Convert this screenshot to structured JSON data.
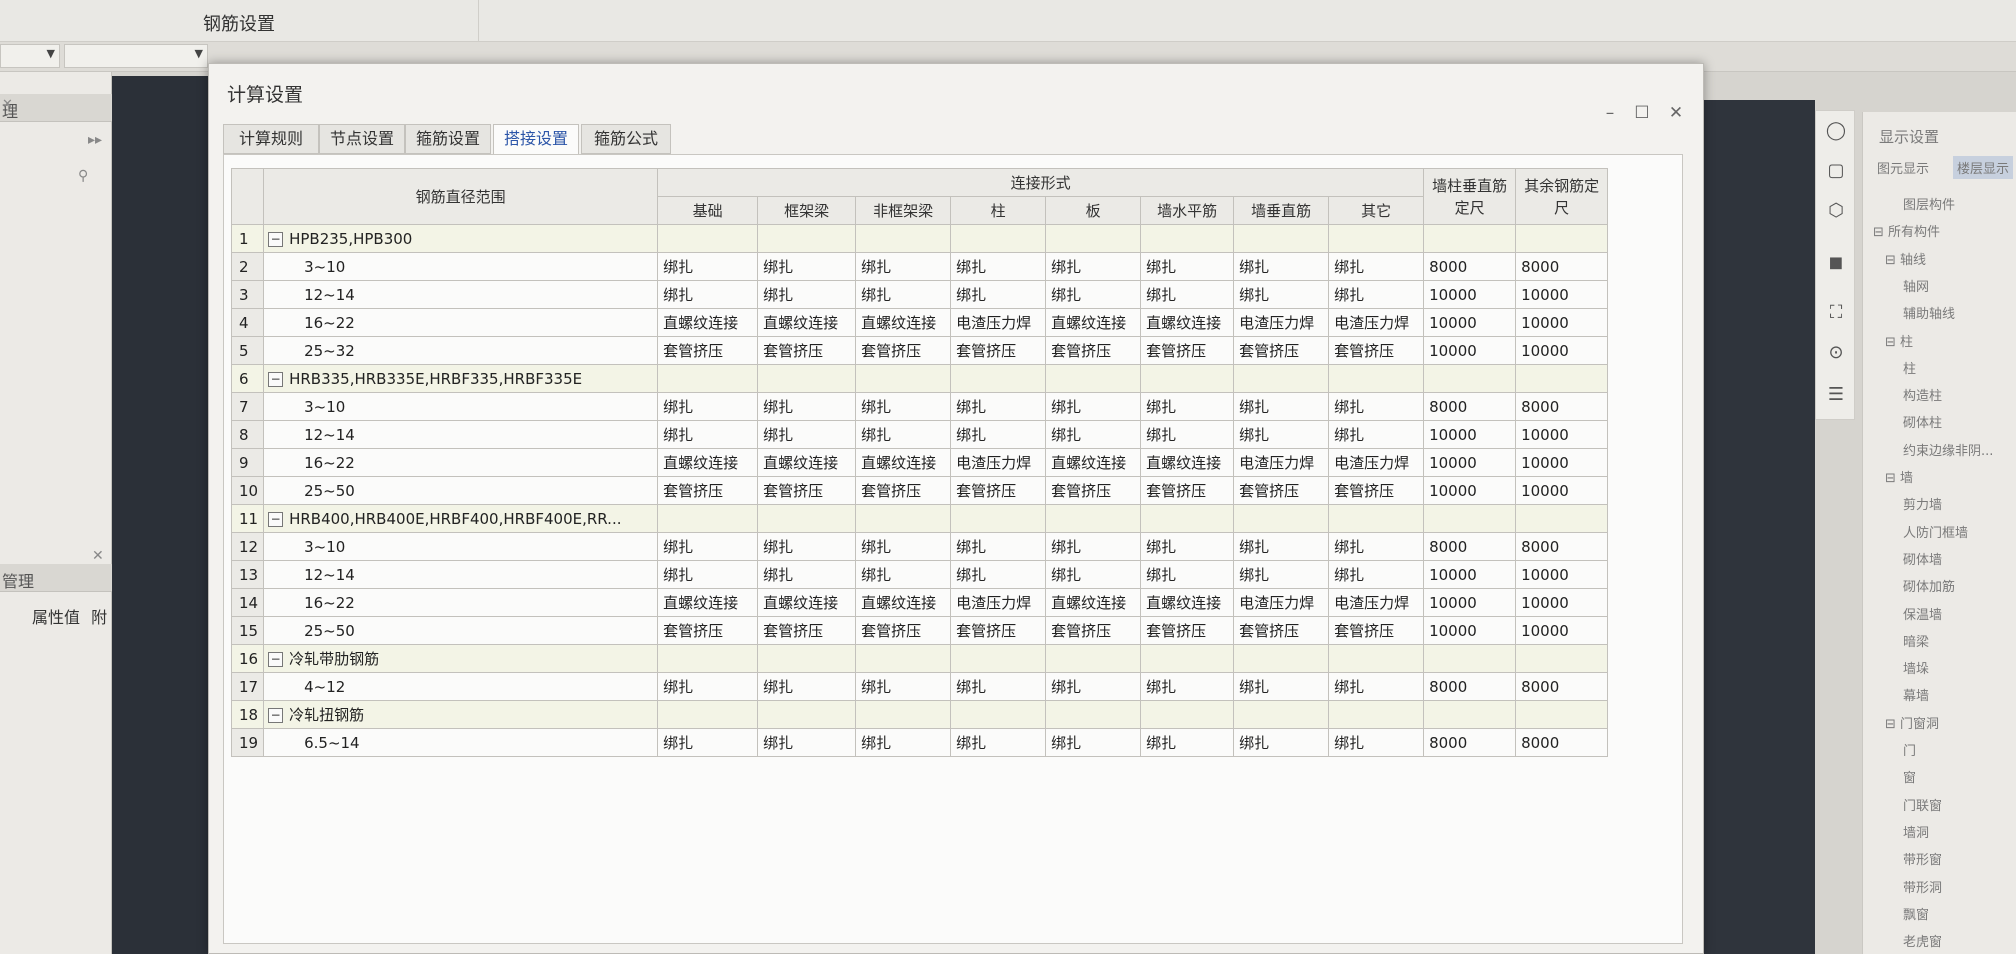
{
  "app": {
    "window_title": "钢筋设置"
  },
  "left_panel": {
    "header1": "理",
    "header2": "管理",
    "prop_value_label": "属性值",
    "prop_col2": "附"
  },
  "dialog": {
    "title": "计算设置",
    "tabs": [
      {
        "label": "计算规则"
      },
      {
        "label": "节点设置"
      },
      {
        "label": "箍筋设置"
      },
      {
        "label": "搭接设置"
      },
      {
        "label": "箍筋公式"
      }
    ],
    "active_tab": "搭接设置"
  },
  "table": {
    "range_header": "钢筋直径范围",
    "conn_header": "连接形式",
    "col_headers": [
      "基础",
      "框架梁",
      "非框架梁",
      "柱",
      "板",
      "墙水平筋",
      "墙垂直筋",
      "其它"
    ],
    "wall_len_header": "墙柱垂直筋定尺",
    "other_len_header": "其余钢筋定尺",
    "rows": [
      {
        "n": "1",
        "group": true,
        "label": "HPB235,HPB300",
        "cells": [
          "",
          "",
          "",
          "",
          "",
          "",
          "",
          "",
          "",
          ""
        ]
      },
      {
        "n": "2",
        "group": false,
        "label": "3~10",
        "cells": [
          "绑扎",
          "绑扎",
          "绑扎",
          "绑扎",
          "绑扎",
          "绑扎",
          "绑扎",
          "绑扎",
          "8000",
          "8000"
        ]
      },
      {
        "n": "3",
        "group": false,
        "label": "12~14",
        "cells": [
          "绑扎",
          "绑扎",
          "绑扎",
          "绑扎",
          "绑扎",
          "绑扎",
          "绑扎",
          "绑扎",
          "10000",
          "10000"
        ]
      },
      {
        "n": "4",
        "group": false,
        "label": "16~22",
        "cells": [
          "直螺纹连接",
          "直螺纹连接",
          "直螺纹连接",
          "电渣压力焊",
          "直螺纹连接",
          "直螺纹连接",
          "电渣压力焊",
          "电渣压力焊",
          "10000",
          "10000"
        ]
      },
      {
        "n": "5",
        "group": false,
        "label": "25~32",
        "cells": [
          "套管挤压",
          "套管挤压",
          "套管挤压",
          "套管挤压",
          "套管挤压",
          "套管挤压",
          "套管挤压",
          "套管挤压",
          "10000",
          "10000"
        ]
      },
      {
        "n": "6",
        "group": true,
        "label": "HRB335,HRB335E,HRBF335,HRBF335E",
        "cells": [
          "",
          "",
          "",
          "",
          "",
          "",
          "",
          "",
          "",
          ""
        ]
      },
      {
        "n": "7",
        "group": false,
        "label": "3~10",
        "cells": [
          "绑扎",
          "绑扎",
          "绑扎",
          "绑扎",
          "绑扎",
          "绑扎",
          "绑扎",
          "绑扎",
          "8000",
          "8000"
        ]
      },
      {
        "n": "8",
        "group": false,
        "label": "12~14",
        "cells": [
          "绑扎",
          "绑扎",
          "绑扎",
          "绑扎",
          "绑扎",
          "绑扎",
          "绑扎",
          "绑扎",
          "10000",
          "10000"
        ]
      },
      {
        "n": "9",
        "group": false,
        "label": "16~22",
        "cells": [
          "直螺纹连接",
          "直螺纹连接",
          "直螺纹连接",
          "电渣压力焊",
          "直螺纹连接",
          "直螺纹连接",
          "电渣压力焊",
          "电渣压力焊",
          "10000",
          "10000"
        ]
      },
      {
        "n": "10",
        "group": false,
        "label": "25~50",
        "cells": [
          "套管挤压",
          "套管挤压",
          "套管挤压",
          "套管挤压",
          "套管挤压",
          "套管挤压",
          "套管挤压",
          "套管挤压",
          "10000",
          "10000"
        ]
      },
      {
        "n": "11",
        "group": true,
        "label": "HRB400,HRB400E,HRBF400,HRBF400E,RR...",
        "cells": [
          "",
          "",
          "",
          "",
          "",
          "",
          "",
          "",
          "",
          ""
        ]
      },
      {
        "n": "12",
        "group": false,
        "label": "3~10",
        "cells": [
          "绑扎",
          "绑扎",
          "绑扎",
          "绑扎",
          "绑扎",
          "绑扎",
          "绑扎",
          "绑扎",
          "8000",
          "8000"
        ]
      },
      {
        "n": "13",
        "group": false,
        "label": "12~14",
        "cells": [
          "绑扎",
          "绑扎",
          "绑扎",
          "绑扎",
          "绑扎",
          "绑扎",
          "绑扎",
          "绑扎",
          "10000",
          "10000"
        ]
      },
      {
        "n": "14",
        "group": false,
        "label": "16~22",
        "cells": [
          "直螺纹连接",
          "直螺纹连接",
          "直螺纹连接",
          "电渣压力焊",
          "直螺纹连接",
          "直螺纹连接",
          "电渣压力焊",
          "电渣压力焊",
          "10000",
          "10000"
        ]
      },
      {
        "n": "15",
        "group": false,
        "label": "25~50",
        "cells": [
          "套管挤压",
          "套管挤压",
          "套管挤压",
          "套管挤压",
          "套管挤压",
          "套管挤压",
          "套管挤压",
          "套管挤压",
          "10000",
          "10000"
        ]
      },
      {
        "n": "16",
        "group": true,
        "label": "冷轧带肋钢筋",
        "cells": [
          "",
          "",
          "",
          "",
          "",
          "",
          "",
          "",
          "",
          ""
        ]
      },
      {
        "n": "17",
        "group": false,
        "label": "4~12",
        "cells": [
          "绑扎",
          "绑扎",
          "绑扎",
          "绑扎",
          "绑扎",
          "绑扎",
          "绑扎",
          "绑扎",
          "8000",
          "8000"
        ]
      },
      {
        "n": "18",
        "group": true,
        "label": "冷轧扭钢筋",
        "cells": [
          "",
          "",
          "",
          "",
          "",
          "",
          "",
          "",
          "",
          ""
        ]
      },
      {
        "n": "19",
        "group": false,
        "label": "6.5~14",
        "cells": [
          "绑扎",
          "绑扎",
          "绑扎",
          "绑扎",
          "绑扎",
          "绑扎",
          "绑扎",
          "绑扎",
          "8000",
          "8000"
        ]
      }
    ]
  },
  "right_panel": {
    "title": "显示设置",
    "tab1": "图元显示",
    "tab2": "楼层显示",
    "tree": [
      "图层构件",
      "所有构件",
      "轴线",
      "轴网",
      "辅助轴线",
      "柱",
      "柱",
      "构造柱",
      "砌体柱",
      "约束边缘非阴...",
      "墙",
      "剪力墙",
      "人防门框墙",
      "砌体墙",
      "砌体加筋",
      "保温墙",
      "暗梁",
      "墙垛",
      "幕墙",
      "门窗洞",
      "门",
      "窗",
      "门联窗",
      "墙洞",
      "带形窗",
      "带形洞",
      "飘窗",
      "老虎窗"
    ]
  }
}
